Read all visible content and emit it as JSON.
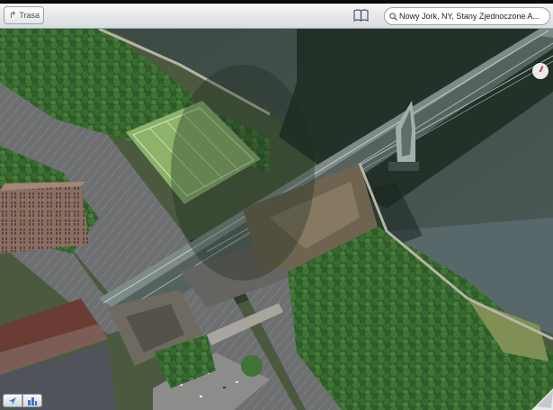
{
  "status_bar": {
    "carrier": "",
    "time": ""
  },
  "toolbar": {
    "route_label": "Trasa",
    "bookmarks_icon": "book-icon",
    "search_value": "Nowy Jork, NY, Stany Zjednoczone A..."
  },
  "map": {
    "view": "satellite-3d",
    "controls": {
      "compass_icon": "compass-icon",
      "location_icon": "location-arrow-icon",
      "mode_icon": "buildings-3d-icon",
      "page_curl_icon": "page-curl-icon"
    }
  }
}
